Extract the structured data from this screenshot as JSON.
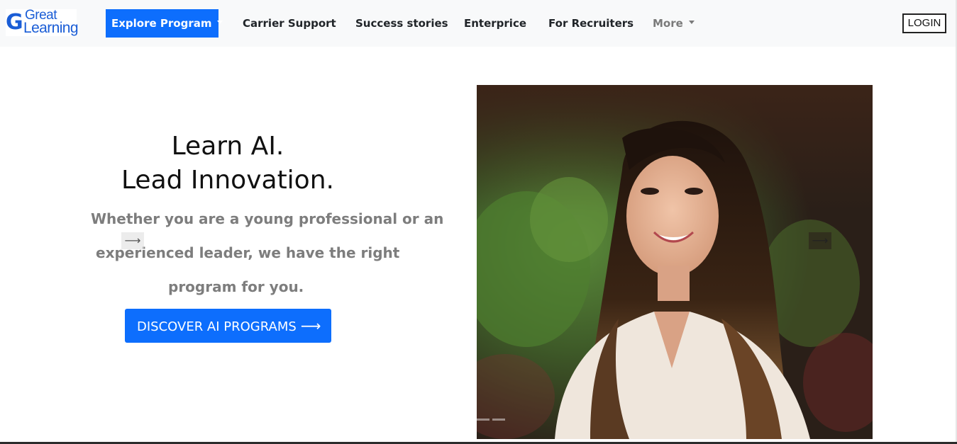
{
  "brand": {
    "line1": "Great",
    "line2": "Learning",
    "color": "#1a5dd6"
  },
  "nav": {
    "explore_label": "Explore Program",
    "items": [
      "Carrier Support",
      "Success stories",
      "Enterprice",
      "For Recruiters"
    ],
    "more_label": "More",
    "login_label": "LOGIN"
  },
  "hero": {
    "title_line1": "Learn AI.",
    "title_line2": "Lead Innovation.",
    "desc_line1": "Whether you are a young professional or an",
    "desc_line2": "experienced leader, we have the right",
    "desc_line3": "program for you.",
    "cta_label": "DISCOVER AI PROGRAMS",
    "prev_icon": "arrow-right-icon",
    "next_icon": "arrow-right-icon"
  },
  "colors": {
    "primary": "#0d6efd",
    "navbar_bg": "#f8f9fa",
    "muted_text": "#7d7d7d"
  }
}
